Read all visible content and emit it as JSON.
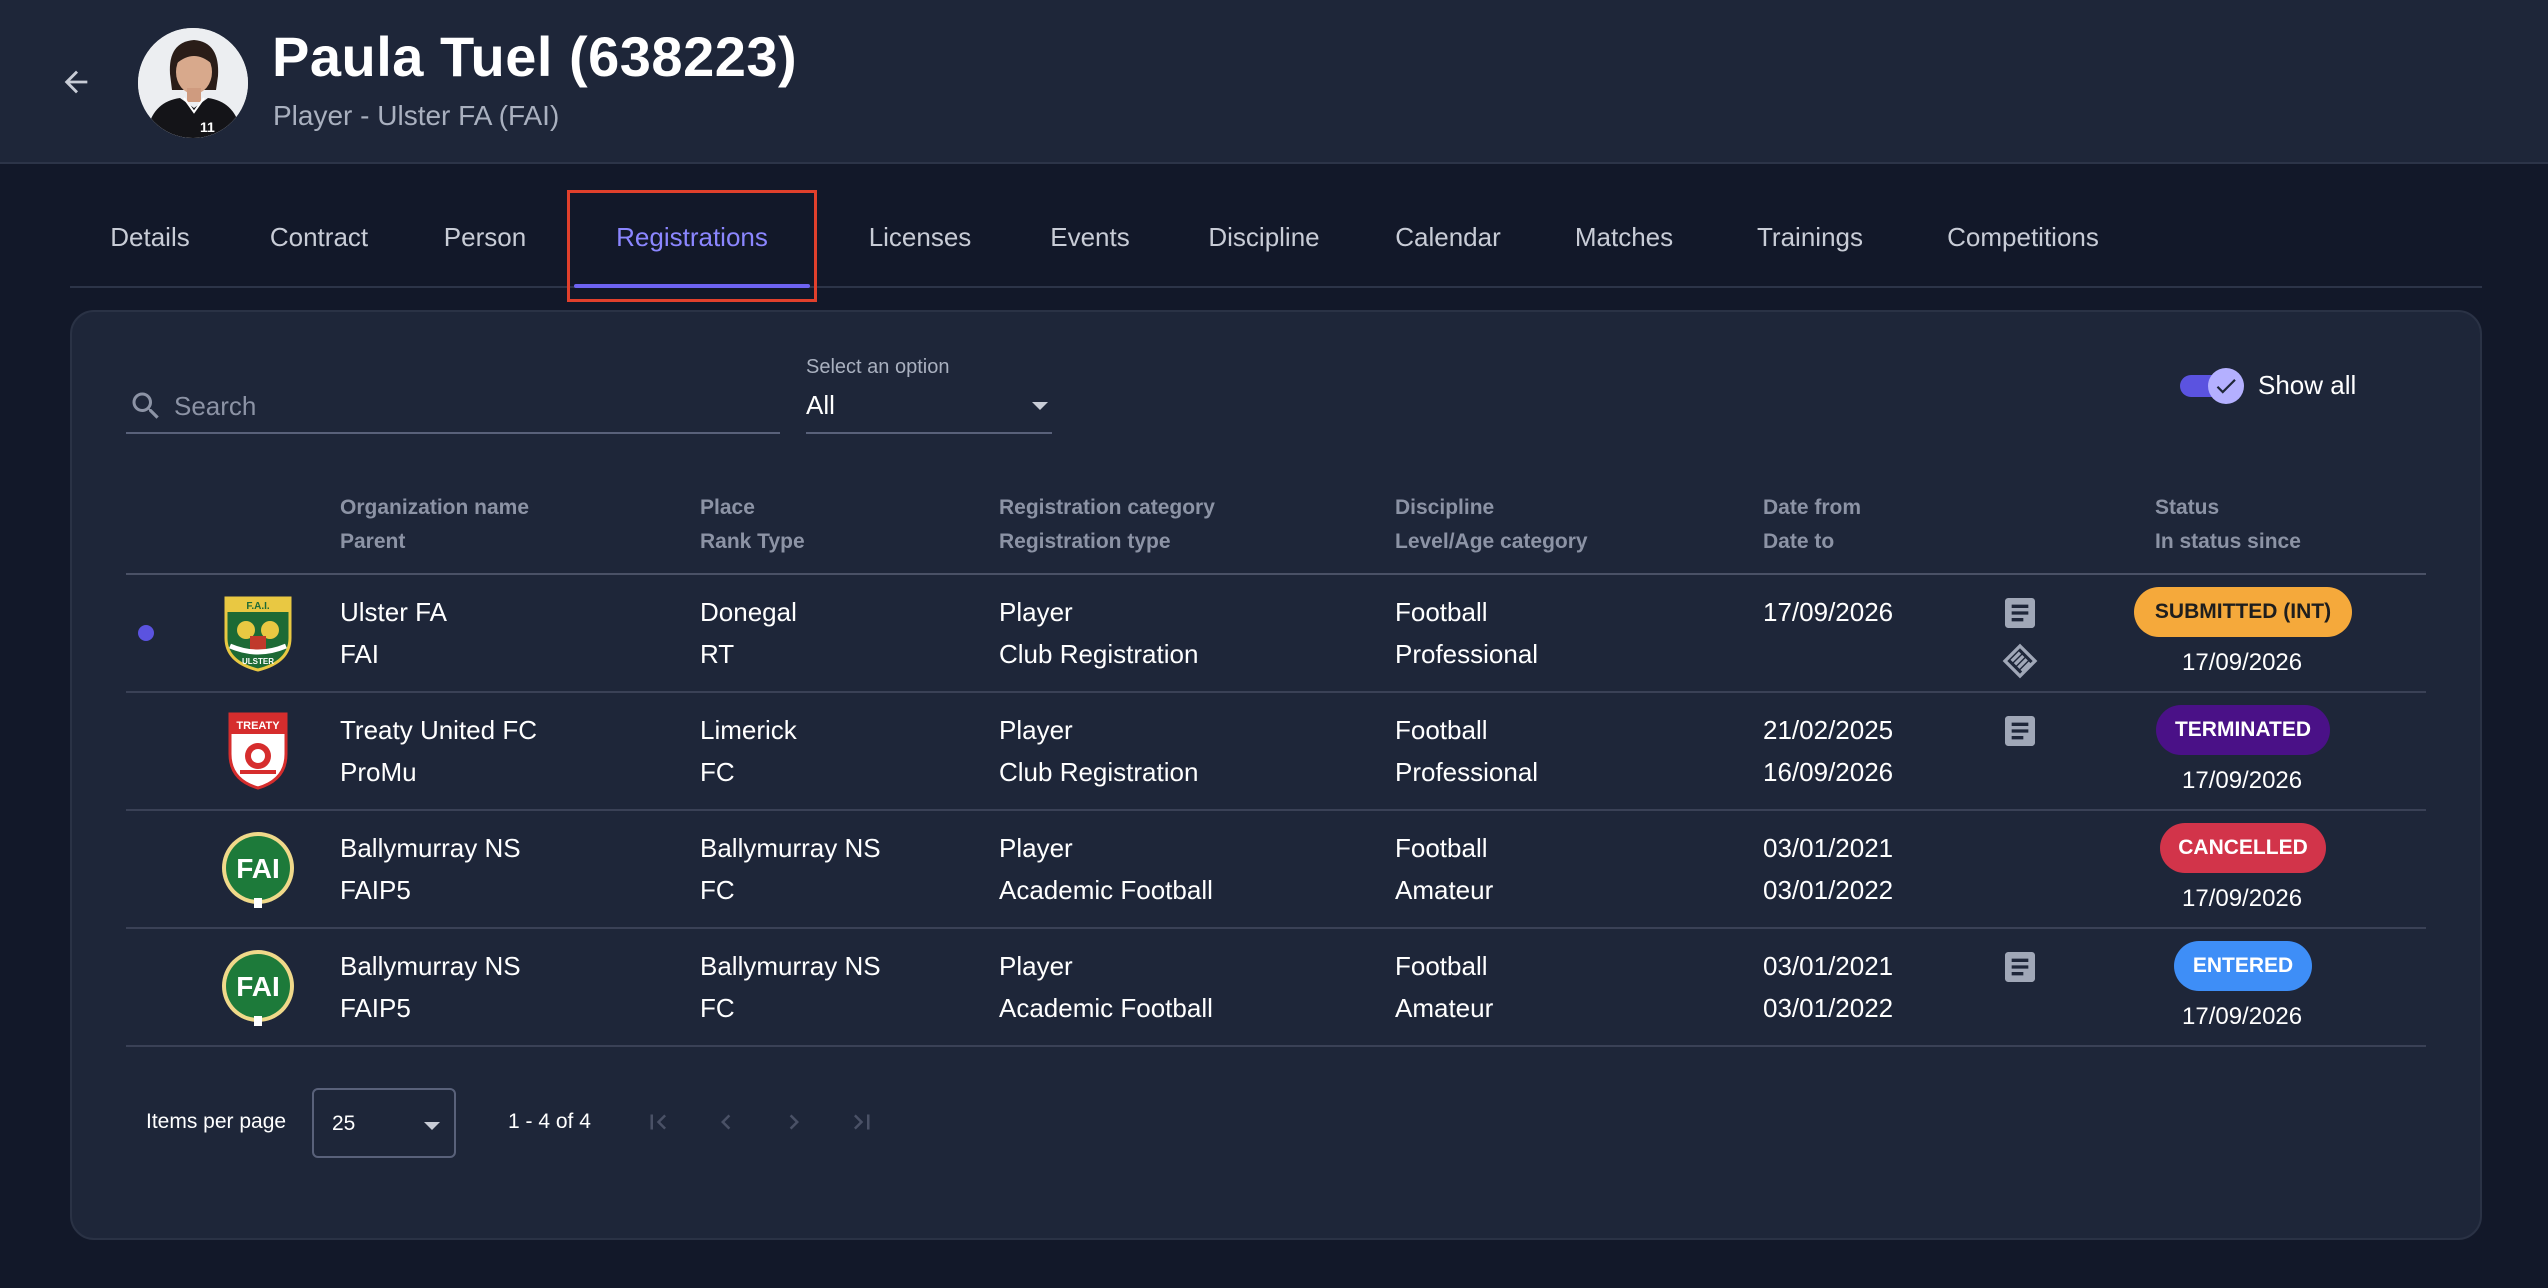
{
  "header": {
    "title": "Paula Tuel (638223)",
    "subtitle": "Player - Ulster FA (FAI)",
    "jersey_number": "11"
  },
  "tabs": [
    {
      "label": "Details",
      "active": false
    },
    {
      "label": "Contract",
      "active": false
    },
    {
      "label": "Person",
      "active": false
    },
    {
      "label": "Registrations",
      "active": true
    },
    {
      "label": "Licenses",
      "active": false
    },
    {
      "label": "Events",
      "active": false
    },
    {
      "label": "Discipline",
      "active": false
    },
    {
      "label": "Calendar",
      "active": false
    },
    {
      "label": "Matches",
      "active": false
    },
    {
      "label": "Trainings",
      "active": false
    },
    {
      "label": "Competitions",
      "active": false
    }
  ],
  "filters": {
    "search_placeholder": "Search",
    "select_label": "Select an option",
    "select_value": "All",
    "show_all_label": "Show all",
    "show_all_enabled": true
  },
  "table": {
    "headers": {
      "org": "Organization name",
      "parent": "Parent",
      "place": "Place",
      "rank_type": "Rank Type",
      "reg_category": "Registration category",
      "reg_type": "Registration type",
      "discipline": "Discipline",
      "level": "Level/Age category",
      "date_from": "Date from",
      "date_to": "Date to",
      "status": "Status",
      "status_since": "In status since"
    },
    "rows": [
      {
        "org": "Ulster FA",
        "parent": "FAI",
        "place": "Donegal",
        "rank_type": "RT",
        "reg_category": "Player",
        "reg_type": "Club Registration",
        "discipline": "Football",
        "level": "Professional",
        "date_from": "17/09/2026",
        "date_to": "",
        "status": "SUBMITTED (INT)",
        "status_since": "17/09/2026",
        "logo": "ulster-crest",
        "selected": true
      },
      {
        "org": "Treaty United FC",
        "parent": "ProMu",
        "place": "Limerick",
        "rank_type": "FC",
        "reg_category": "Player",
        "reg_type": "Club Registration",
        "discipline": "Football",
        "level": "Professional",
        "date_from": "21/02/2025",
        "date_to": "16/09/2026",
        "status": "TERMINATED",
        "status_since": "17/09/2026",
        "logo": "treaty-crest",
        "selected": false
      },
      {
        "org": "Ballymurray NS",
        "parent": "FAIP5",
        "place": "Ballymurray NS",
        "rank_type": "FC",
        "reg_category": "Player",
        "reg_type": "Academic Football",
        "discipline": "Football",
        "level": "Amateur",
        "date_from": "03/01/2021",
        "date_to": "03/01/2022",
        "status": "CANCELLED",
        "status_since": "17/09/2026",
        "logo": "fai-crest",
        "selected": false
      },
      {
        "org": "Ballymurray NS",
        "parent": "FAIP5",
        "place": "Ballymurray NS",
        "rank_type": "FC",
        "reg_category": "Player",
        "reg_type": "Academic Football",
        "discipline": "Football",
        "level": "Amateur",
        "date_from": "03/01/2021",
        "date_to": "03/01/2022",
        "status": "ENTERED",
        "status_since": "17/09/2026",
        "logo": "fai-crest",
        "selected": false
      }
    ],
    "logo_texts": {
      "ulster_top": "F.A.I.",
      "ulster_bottom": "ULSTER",
      "treaty": "TREATY",
      "fai": "FAI"
    }
  },
  "pagination": {
    "items_per_page_label": "Items per page",
    "items_per_page_value": "25",
    "range_label": "1 - 4 of 4"
  },
  "colors": {
    "background": "#121829",
    "panel": "#1e2639",
    "accent": "#6e63f2",
    "highlight_box": "#e1402c",
    "submitted_badge": "#f5a93b",
    "terminated_badge": "#4a1187",
    "cancelled_badge": "#d2344a",
    "entered_badge": "#3e8ef7"
  }
}
